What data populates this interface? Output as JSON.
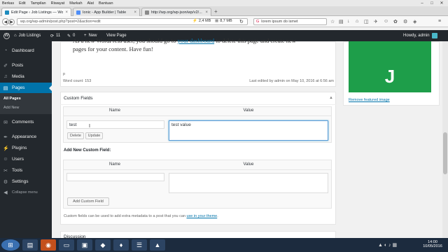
{
  "browser": {
    "menu": [
      "Berkas",
      "Edit",
      "Tampilan",
      "Riwayat",
      "Markah",
      "Alat",
      "Bantuan"
    ],
    "tabs": [
      {
        "label": "Edit Page ‹ Job Listings — Wor...",
        "color": "#1e8cbe"
      },
      {
        "label": "Ionic - App Builder | Table",
        "color": "#4f8ef7"
      },
      {
        "label": "http://wp.org/wp-json/wp/v2/...",
        "color": "#8a8a8a"
      }
    ],
    "url": "wp.org/wp-admin/post.php?post=2&action=edit",
    "stat1": "2,4 MB",
    "stat2": "8,7 MB",
    "search": "lorem ipsum do ismet"
  },
  "adminbar": {
    "site": "Job Listings",
    "updates": "11",
    "comments": "0",
    "new": "New",
    "view": "View Page",
    "howdy": "Howdy, admin"
  },
  "sidebar": {
    "items": [
      {
        "label": "Dashboard",
        "icon": "dashboard-icon"
      },
      {
        "label": "Posts",
        "icon": "pin-icon"
      },
      {
        "label": "Media",
        "icon": "media-icon"
      },
      {
        "label": "Pages",
        "icon": "pages-icon"
      },
      {
        "label": "Comments",
        "icon": "comment-icon"
      },
      {
        "label": "Appearance",
        "icon": "brush-icon"
      },
      {
        "label": "Plugins",
        "icon": "plug-icon"
      },
      {
        "label": "Users",
        "icon": "user-icon"
      },
      {
        "label": "Tools",
        "icon": "wrench-icon"
      },
      {
        "label": "Settings",
        "icon": "settings-icon"
      }
    ],
    "sub": [
      "All Pages",
      "Add New"
    ],
    "collapse": "Collapse menu"
  },
  "editor": {
    "line1a": "As a new WordPress user, you should go to ",
    "line1b": "your dashboard",
    "line1c": " to delete this page and create new",
    "line2": "pages for your content. Have fun!",
    "path": "p",
    "wordcount": "Word count: 153",
    "lastedited": "Last edited by admin on May 10, 2016 at 6:56 am"
  },
  "customfields": {
    "title": "Custom Fields",
    "col_name": "Name",
    "col_value": "Value",
    "field_name": "test",
    "field_value": "test value",
    "delete": "Delete",
    "update": "Update",
    "addnew_label": "Add New Custom Field:",
    "add_button": "Add Custom Field",
    "help": "Custom fields can be used to add extra metadata to a post that you can ",
    "help_link": "use in your theme",
    "help_end": "."
  },
  "discussion": {
    "title": "Discussion"
  },
  "featured": {
    "remove": "Remove featured image",
    "letter": "J",
    "color": "#1e9e4a"
  },
  "taskbar": {
    "time": "14:00",
    "date": "10/05/2016"
  }
}
